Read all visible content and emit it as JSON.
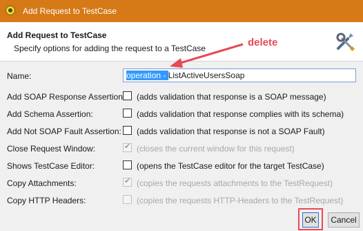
{
  "window": {
    "title": "Add Request to TestCase"
  },
  "header": {
    "title": "Add Request to TestCase",
    "description": "Specify options for adding the request to a TestCase"
  },
  "annotation": {
    "text": "delete",
    "color": "#e84a55"
  },
  "form": {
    "name_label": "Name:",
    "name_selected": "operation - ",
    "name_rest": "ListActiveUsersSoap",
    "rows": [
      {
        "label": "Add SOAP Response Assertion:",
        "description": "(adds validation that response is a SOAP message)",
        "checked": false,
        "enabled": true
      },
      {
        "label": "Add Schema Assertion:",
        "description": "(adds validation that response complies with its schema)",
        "checked": false,
        "enabled": true
      },
      {
        "label": "Add Not SOAP Fault Assertion:",
        "description": "(adds validation that response is not a SOAP Fault)",
        "checked": false,
        "enabled": true
      },
      {
        "label": "Close Request Window:",
        "description": "(closes the current window for this request)",
        "checked": true,
        "enabled": false
      },
      {
        "label": "Shows TestCase Editor:",
        "description": "(opens the TestCase editor for the target TestCase)",
        "checked": false,
        "enabled": true
      },
      {
        "label": "Copy Attachments:",
        "description": "(copies the requests attachments to the TestRequest)",
        "checked": true,
        "enabled": false
      },
      {
        "label": "Copy HTTP Headers:",
        "description": "(copies the requests HTTP-Headers to the TestRequest)",
        "checked": false,
        "enabled": false
      }
    ]
  },
  "buttons": {
    "ok": "OK",
    "cancel": "Cancel"
  },
  "icons": {
    "app": "soapui-icon",
    "tools": "tools-icon"
  }
}
